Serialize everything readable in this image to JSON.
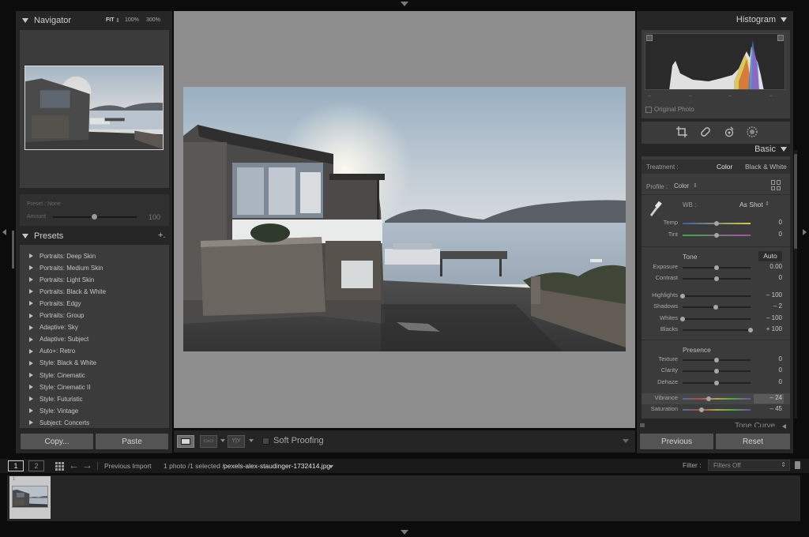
{
  "navigator": {
    "title": "Navigator",
    "zoom_fit": "FIT",
    "zoom_100": "100%",
    "zoom_300": "300%",
    "preset_label": "Preset : None",
    "amount_label": "Amount",
    "amount_value": "100"
  },
  "presets": {
    "title": "Presets",
    "add_symbol": "+.",
    "items": [
      "Portraits: Deep Skin",
      "Portraits: Medium Skin",
      "Portraits: Light Skin",
      "Portraits: Black & White",
      "Portraits: Edgy",
      "Portraits: Group",
      "Adaptive: Sky",
      "Adaptive: Subject",
      "Auto+: Retro",
      "Style: Black & White",
      "Style: Cinematic",
      "Style: Cinematic II",
      "Style: Futuristic",
      "Style: Vintage",
      "Subject: Concerts"
    ],
    "copy_label": "Copy...",
    "paste_label": "Paste"
  },
  "toolbar": {
    "soft_proofing_label": "Soft Proofing",
    "soft_proofing_checked": false
  },
  "histogram": {
    "title": "Histogram",
    "original_photo_label": "Original Photo",
    "readouts": [
      "–",
      "–",
      "–",
      "–"
    ]
  },
  "basic": {
    "title": "Basic",
    "treatment_label": "Treatment :",
    "treatment_options": [
      "Color",
      "Black & White"
    ],
    "treatment_selected": "Color",
    "profile_label": "Profile :",
    "profile_value": "Color",
    "wb_label": "WB :",
    "wb_value": "As Shot",
    "temp": {
      "label": "Temp",
      "value": "0",
      "level": 0.5
    },
    "tint": {
      "label": "Tint",
      "value": "0",
      "level": 0.5
    },
    "tone_label": "Tone",
    "auto_label": "Auto",
    "exposure": {
      "label": "Exposure",
      "value": "0.00",
      "level": 0.5
    },
    "contrast": {
      "label": "Contrast",
      "value": "0",
      "level": 0.5
    },
    "highlights": {
      "label": "Highlights",
      "value": "– 100",
      "level": 0
    },
    "shadows": {
      "label": "Shadows",
      "value": "– 2",
      "level": 0.49
    },
    "whites": {
      "label": "Whites",
      "value": "– 100",
      "level": 0
    },
    "blacks": {
      "label": "Blacks",
      "value": "+ 100",
      "level": 1
    },
    "presence_label": "Presence",
    "texture": {
      "label": "Texture",
      "value": "0",
      "level": 0.5
    },
    "clarity": {
      "label": "Clarity",
      "value": "0",
      "level": 0.5
    },
    "dehaze": {
      "label": "Dehaze",
      "value": "0",
      "level": 0.5
    },
    "vibrance": {
      "label": "Vibrance",
      "value": "– 24",
      "level": 0.38
    },
    "saturation": {
      "label": "Saturation",
      "value": "– 45",
      "level": 0.28
    },
    "tone_curve_label": "Tone Curve"
  },
  "right_buttons": {
    "previous_label": "Previous",
    "reset_label": "Reset"
  },
  "filmstrip": {
    "view1": "1",
    "view2": "2",
    "source": "Previous Import",
    "count_text": "1 photo /1 selected /",
    "filename": "pexels-alex-staudinger-1732414.jpg",
    "filter_label": "Filter :",
    "filter_value": "Filters Off",
    "thumb_index": "1"
  },
  "colors": {
    "panel_bg": "#262626",
    "section_bg": "#3b3b3b",
    "center_bg": "#8d8d8d",
    "text_light": "#cfcfcf"
  }
}
